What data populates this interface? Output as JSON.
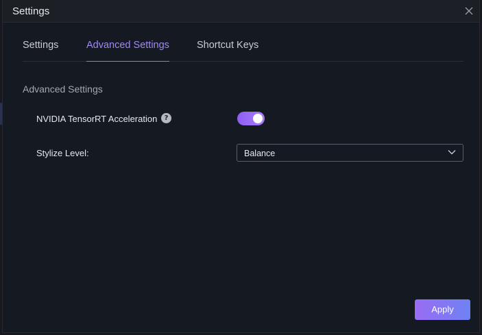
{
  "window": {
    "title": "Settings"
  },
  "tabs": [
    {
      "label": "Settings",
      "active": false
    },
    {
      "label": "Advanced Settings",
      "active": true
    },
    {
      "label": "Shortcut Keys",
      "active": false
    }
  ],
  "section": {
    "title": "Advanced Settings"
  },
  "options": {
    "tensorrt": {
      "label": "NVIDIA TensorRT Acceleration",
      "help_icon": "question-mark-icon",
      "help_glyph": "?",
      "enabled": true
    },
    "stylize_level": {
      "label": "Stylize Level:",
      "value": "Balance",
      "icon": "chevron-down-icon"
    }
  },
  "footer": {
    "apply_label": "Apply"
  },
  "colors": {
    "background": "#151a22",
    "accent": "#9a6cf4",
    "accent_secondary": "#6e82f2",
    "active_tab": "#a188f5",
    "text_primary": "#e6e8ec",
    "text_muted": "#a4a8b0"
  }
}
